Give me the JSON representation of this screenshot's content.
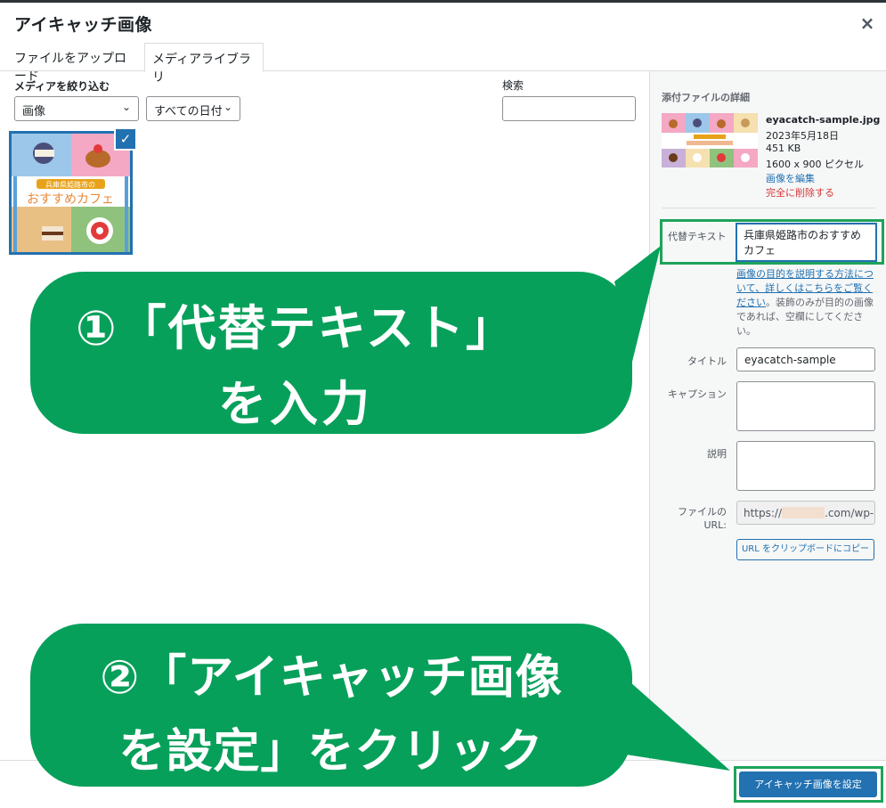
{
  "modal": {
    "title": "アイキャッチ画像",
    "close_label": "×"
  },
  "tabs": [
    {
      "label": "ファイルをアップロード",
      "active": false
    },
    {
      "label": "メディアライブラリ",
      "active": true
    }
  ],
  "toolbar": {
    "filter_label": "メディアを絞り込む",
    "type_filter": "画像",
    "date_filter": "すべての日付",
    "search_label": "検索",
    "search_value": ""
  },
  "attachment": {
    "selected": true,
    "image_badge": "兵庫県姫路市の",
    "image_title": "おすすめカフェ"
  },
  "details": {
    "heading": "添付ファイルの詳細",
    "filename": "eyacatch-sample.jpg",
    "date": "2023年5月18日",
    "filesize": "451 KB",
    "dimensions": "1600 x 900 ピクセル",
    "edit_link": "画像を編集",
    "delete_link": "完全に削除する"
  },
  "fields": {
    "alt_label": "代替テキスト",
    "alt_value": "兵庫県姫路市のおすすめカフェ",
    "alt_help_link": "画像の目的を説明する方法について、詳しくはこちらをご覧ください",
    "alt_help_rest": "。装飾のみが目的の画像であれば、空欄にしてください。",
    "title_label": "タイトル",
    "title_value": "eyacatch-sample",
    "caption_label": "キャプション",
    "caption_value": "",
    "description_label": "説明",
    "description_value": "",
    "url_label": "ファイルの URL:",
    "url_prefix": "https://",
    "url_suffix": ".com/wp-",
    "copy_button": "URL をクリップボードにコピー"
  },
  "footer": {
    "set_button": "アイキャッチ画像を設定"
  },
  "callouts": {
    "step1_line1": "①「代替テキスト」",
    "step1_line2": "を入力",
    "step2_line1": "②「アイキャッチ画像",
    "step2_line2": "を設定」をクリック"
  },
  "colors": {
    "accent": "#2271b1",
    "callout": "#07a05a",
    "highlight_frame": "#1ea35a",
    "danger": "#d63638"
  },
  "icons": {
    "close": "close-icon",
    "chevron": "chevron-down-icon",
    "check": "check-icon"
  }
}
